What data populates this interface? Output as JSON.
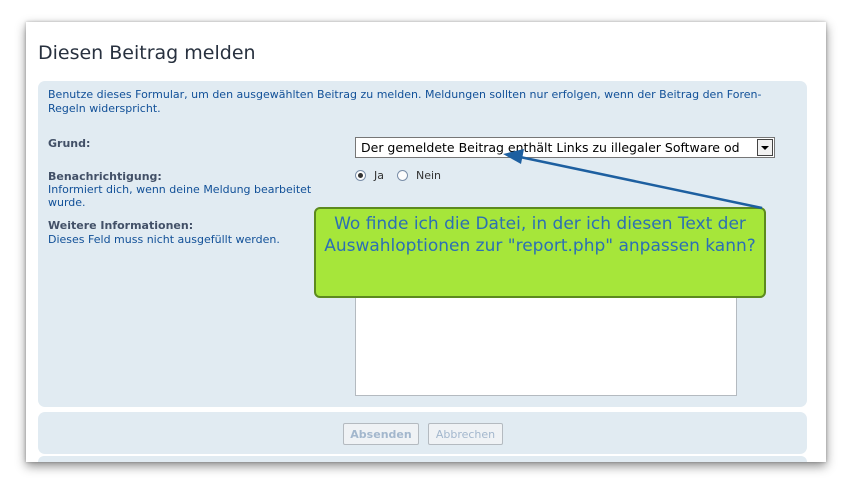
{
  "page": {
    "title": "Diesen Beitrag melden",
    "intro": "Benutze dieses Formular, um den ausgewählten Beitrag zu melden. Meldungen sollten nur erfolgen, wenn der Beitrag den Foren-Regeln widerspricht."
  },
  "form": {
    "reason": {
      "label": "Grund:",
      "selected": "Der gemeldete Beitrag enthält Links zu illegaler Software od"
    },
    "notify": {
      "label": "Benachrichtigung:",
      "help": "Informiert dich, wenn deine Meldung bearbeitet wurde.",
      "yes_label": "Ja",
      "no_label": "Nein",
      "selected": "Ja"
    },
    "more_info": {
      "label": "Weitere Informationen:",
      "help": "Dieses Feld muss nicht ausgefüllt werden.",
      "value": ""
    }
  },
  "buttons": {
    "submit": "Absenden",
    "cancel": "Abbrechen"
  },
  "annotation": {
    "text": "Wo finde ich die Datei, in der ich diesen Text der Auswahloptionen zur \"report.php\" anpassen kann?"
  },
  "colors": {
    "panel_bg": "#e1ebf2",
    "link_blue": "#115098",
    "callout_green": "#a6e63a",
    "callout_text": "#2c6fb4",
    "arrow": "#1d5fa0"
  }
}
